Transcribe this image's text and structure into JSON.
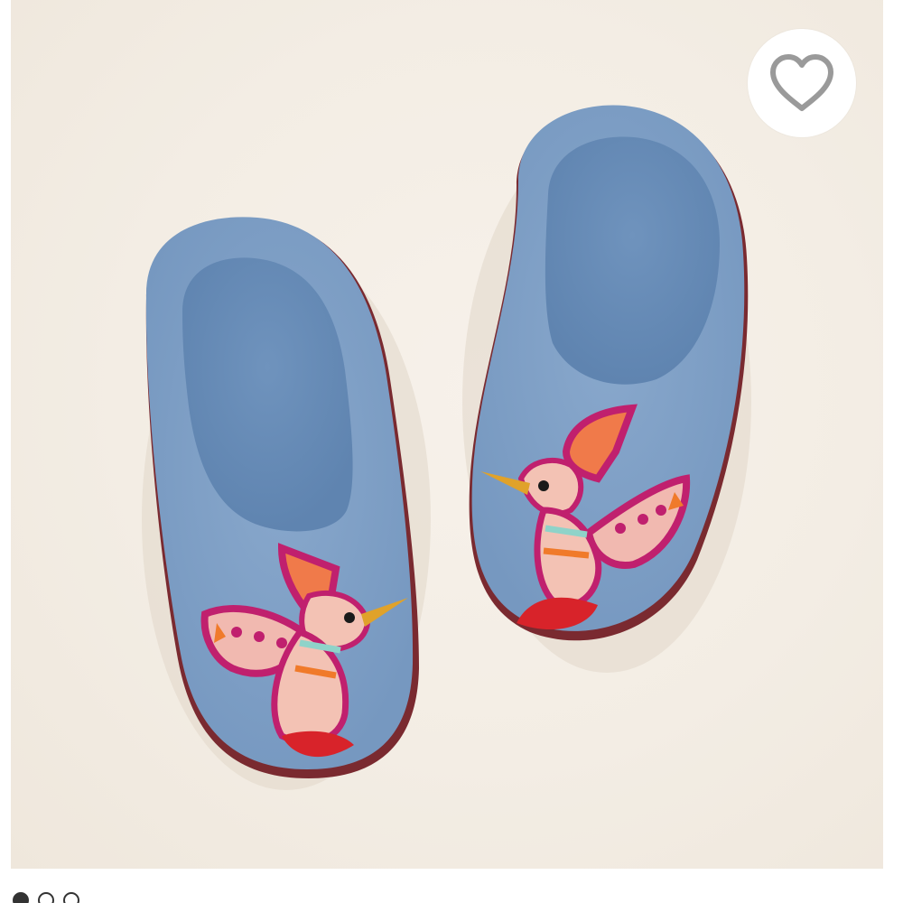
{
  "product_image": {
    "alt": "",
    "colors": {
      "background": "#f3ede4",
      "felt": "#7f9fc4",
      "felt_inner": "#6b8db8",
      "sole": "#8a2b2b"
    }
  },
  "favorite_button": {
    "icon": "heart-outline-icon",
    "state": "not-favorited",
    "icon_color": "#9a9a9a"
  },
  "image_pager": {
    "count": 3,
    "active_index": 0
  }
}
